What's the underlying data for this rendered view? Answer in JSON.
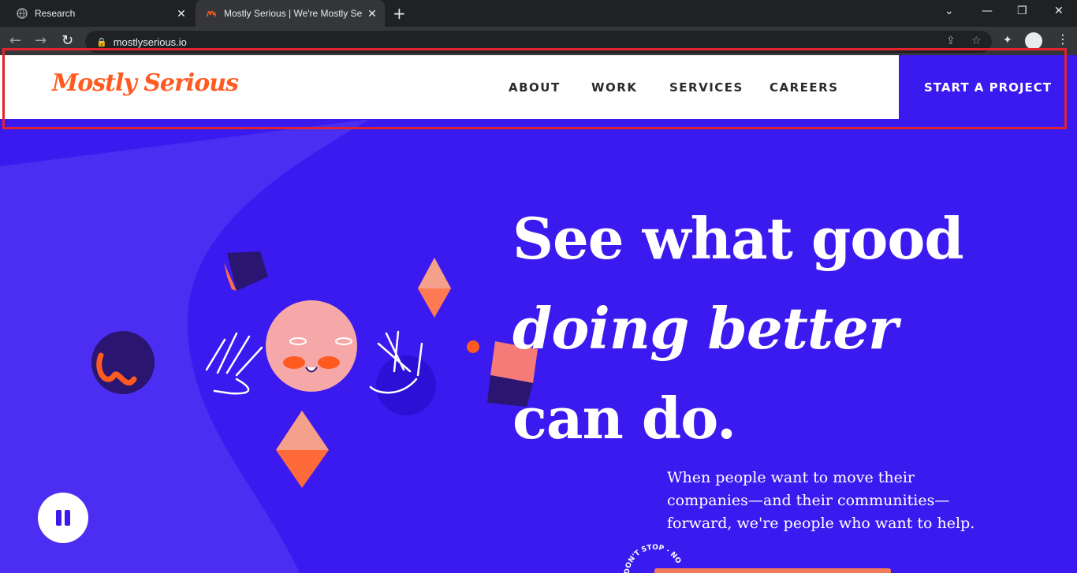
{
  "browser": {
    "tabs": [
      {
        "title": "Research",
        "active": false
      },
      {
        "title": "Mostly Serious | We're Mostly Se",
        "active": true
      }
    ],
    "url": "mostlyserious.io"
  },
  "header": {
    "logo": "Mostly Serious",
    "nav": [
      "ABOUT",
      "WORK",
      "SERVICES",
      "CAREERS"
    ],
    "cta": "START A PROJECT"
  },
  "hero": {
    "headline_line1": "See what good",
    "headline_line2": "doing better",
    "headline_line3": "can do.",
    "subtext": "When people want to move their companies—and their communities—forward, we're people who want to help.",
    "badge_text": "DON'T STOP · NO"
  },
  "colors": {
    "brand_orange": "#ff5a1f",
    "brand_purple": "#3a1aef",
    "highlight_red": "#e0242f"
  }
}
